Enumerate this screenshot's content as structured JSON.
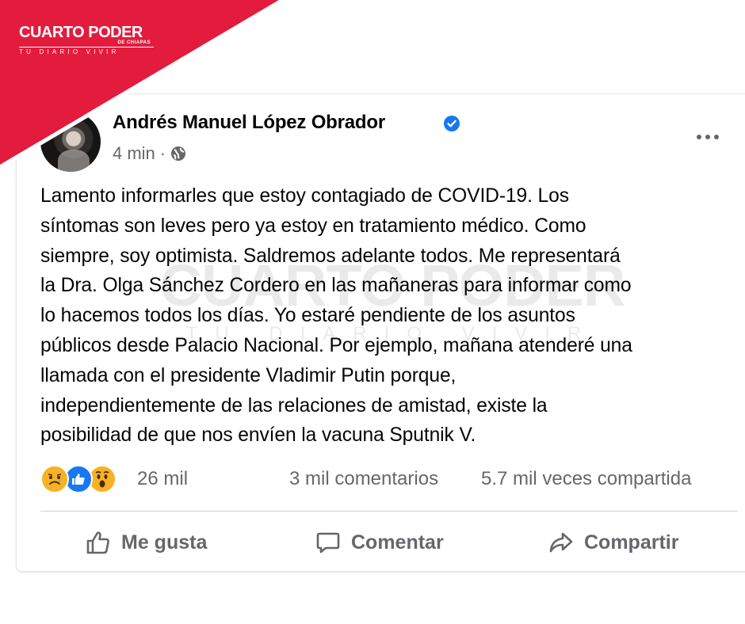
{
  "brand": {
    "name": "CUARTO PODER",
    "region": "DE CHIAPAS",
    "tagline": "TU DIARIO VIVIR",
    "color": "#e31b3d"
  },
  "post": {
    "author": "Andrés Manuel López Obrador",
    "verified_icon": "verified-badge-icon",
    "time": "4 min",
    "separator": "·",
    "privacy_icon": "globe-icon",
    "text": "Lamento informarles que estoy contagiado de COVID-19. Los\nsíntomas son leves pero ya estoy en tratamiento médico. Como\nsiempre, soy optimista. Saldremos adelante todos. Me representará\nla Dra. Olga Sánchez Cordero en las mañaneras para informar como\nlo hacemos todos los días. Yo estaré pendiente de los asuntos\npúblicos desde Palacio Nacional. Por ejemplo, mañana atenderé una\nllamada con el presidente Vladimir Putin porque,\nindependientemente de las relaciones de amistad, existe la\nposibilidad de que nos envíen la vacuna Sputnik V."
  },
  "stats": {
    "reactions": [
      "sad",
      "like",
      "wow"
    ],
    "reaction_count": "26 mil",
    "comments": "3 mil comentarios",
    "shares": "5.7 mil veces compartida"
  },
  "actions": {
    "like": "Me gusta",
    "comment": "Comentar",
    "share": "Compartir"
  },
  "colors": {
    "facebook_blue": "#1877f2",
    "secondary_text": "#65676b",
    "reaction_yellow": "#f7b125"
  }
}
